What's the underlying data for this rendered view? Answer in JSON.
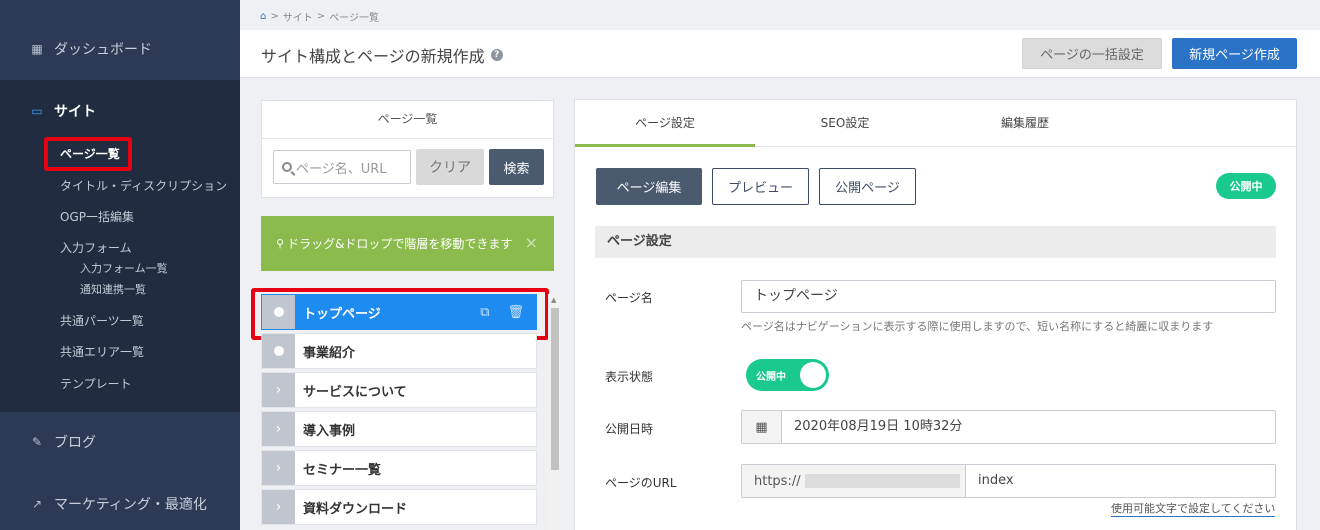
{
  "sidebar": {
    "dashboard": "ダッシュボード",
    "site": "サイト",
    "sub_items": {
      "page_list": "ページ一覧",
      "title_desc": "タイトル・ディスクリプション",
      "ogp": "OGP一括編集",
      "form": "入力フォーム",
      "form_list": "入力フォーム一覧",
      "notify": "通知連携一覧",
      "parts": "共通パーツ一覧",
      "area": "共通エリア一覧",
      "template": "テンプレート"
    },
    "blog": "ブログ",
    "marketing": "マーケティング・最適化"
  },
  "breadcrumb": {
    "sep": ">",
    "site": "サイト",
    "page_list": "ページ一覧"
  },
  "header": {
    "title": "サイト構成とページの新規作成",
    "bulk_button": "ページの一括設定",
    "new_button": "新規ページ作成"
  },
  "list_panel": {
    "title": "ページ一覧",
    "search_placeholder": "ページ名、URL",
    "clear_button": "クリア",
    "search_button": "検索"
  },
  "drag_note": {
    "text": "ドラッグ&ドロップで階層を移動できます",
    "close": "×"
  },
  "tree": {
    "items": [
      {
        "label": "トップページ"
      },
      {
        "label": "事業紹介"
      },
      {
        "label": "サービスについて"
      },
      {
        "label": "導入事例"
      },
      {
        "label": "セミナー一覧"
      },
      {
        "label": "資料ダウンロード"
      }
    ]
  },
  "detail": {
    "tabs": [
      "ページ設定",
      "SEO設定",
      "編集履歴"
    ],
    "edit_button": "ページ編集",
    "preview_button": "プレビュー",
    "public_button": "公開ページ",
    "status_badge": "公開中",
    "section_title": "ページ設定",
    "page_name_label": "ページ名",
    "page_name_value": "トップページ",
    "page_name_help": "ページ名はナビゲーションに表示する際に使用しますので、短い名称にすると綺麗に収まります",
    "display_label": "表示状態",
    "toggle_label": "公開中",
    "publish_date_label": "公開日時",
    "publish_date_value": "2020年08月19日 10時32分",
    "url_label": "ページのURL",
    "url_prefix": "https://",
    "url_value": "index",
    "url_hint": "使用可能文字で設定してください"
  },
  "colors": {
    "sidebar_bg": "#2c3a55",
    "sidebar_section_bg": "#212c41",
    "accent_blue": "#2b73c6",
    "active_item": "#1e8bf0",
    "green": "#8cbb4d",
    "status_green": "#1ac98e",
    "highlight_red": "#e60012"
  }
}
